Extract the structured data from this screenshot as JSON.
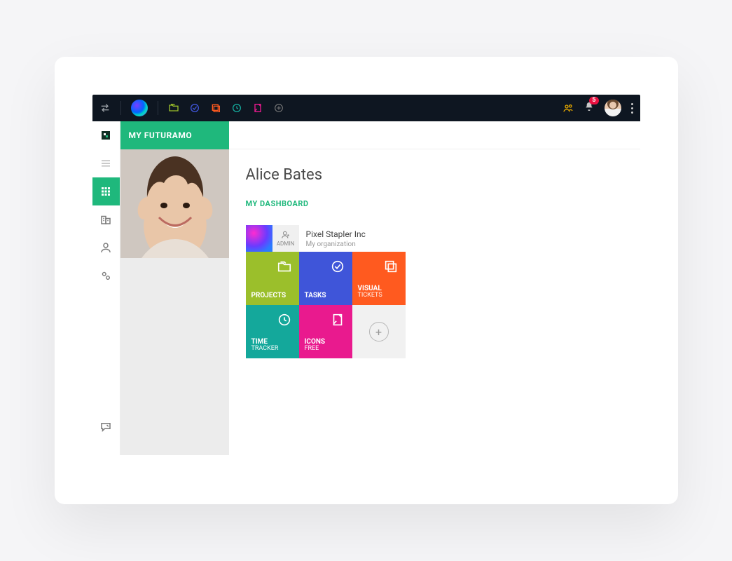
{
  "topbar": {
    "notifications_count": "5"
  },
  "sidebar": {
    "title": "MY FUTURAMO"
  },
  "main": {
    "user_name": "Alice Bates",
    "dashboard_label": "MY DASHBOARD"
  },
  "org": {
    "admin_label": "ADMIN",
    "name": "Pixel Stapler Inc",
    "subtitle": "My organization"
  },
  "tiles": {
    "projects_title": "PROJECTS",
    "tasks_title": "TASKS",
    "visual_title": "VISUAL",
    "visual_sub": "TICKETS",
    "time_title": "TIME",
    "time_sub": "TRACKER",
    "icons_title": "ICONS",
    "icons_sub": "FREE"
  }
}
